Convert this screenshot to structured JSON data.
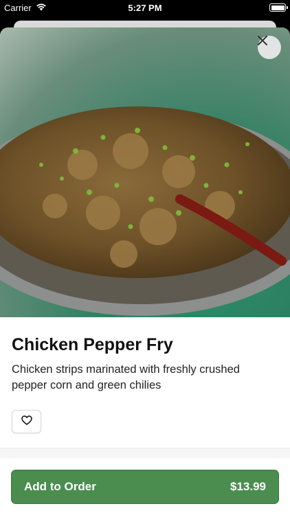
{
  "status_bar": {
    "carrier": "Carrier",
    "time": "5:27 PM",
    "battery_level": 1.0
  },
  "item": {
    "name": "Chicken Pepper Fry",
    "description": "Chicken strips marinated with freshly crushed pepper corn and green chilies"
  },
  "icons": {
    "close": "close-icon",
    "favorite": "heart-outline-icon",
    "wifi": "wifi-icon",
    "battery": "battery-icon"
  },
  "order_button": {
    "label": "Add to Order",
    "price": "$13.99"
  },
  "colors": {
    "accent": "#4a8d4f",
    "plate_backdrop": "#2b7f60"
  }
}
